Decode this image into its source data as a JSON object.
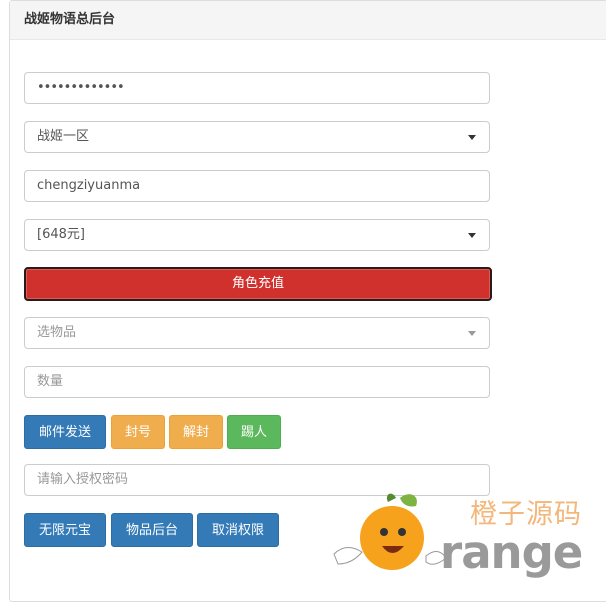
{
  "panel": {
    "title": "战姬物语总后台"
  },
  "form": {
    "password_value": "•••••••••••••",
    "server_select": "战姬一区",
    "account_value": "chengziyuanma",
    "recharge_select": "[648元]",
    "recharge_button": "角色充值",
    "item_placeholder": "选物品",
    "quantity_placeholder": "数量",
    "auth_placeholder": "请输入授权密码"
  },
  "actions": {
    "mail_send": "邮件发送",
    "ban": "封号",
    "unban": "解封",
    "kick": "踢人",
    "unlimited_yuanbao": "无限元宝",
    "item_backend": "物品后台",
    "revoke": "取消权限"
  },
  "watermark": {
    "cn_text": "橙子源码",
    "en_text": "range"
  },
  "colors": {
    "primary": "#337ab7",
    "warning": "#f0ad4e",
    "success": "#5cb85c",
    "danger": "#d1312c"
  }
}
